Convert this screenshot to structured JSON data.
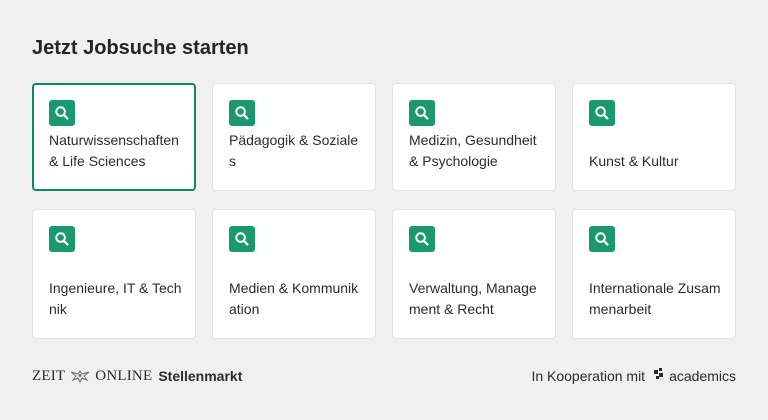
{
  "header": {
    "title": "Jetzt Jobsuche starten"
  },
  "categories": [
    {
      "label": "Naturwissenschaften & Life Sciences",
      "icon": "search-icon",
      "active": true
    },
    {
      "label": "Pädagogik & Soziales",
      "icon": "search-icon"
    },
    {
      "label": "Medizin, Gesundheit & Psychologie",
      "icon": "search-icon"
    },
    {
      "label": "Kunst & Kultur",
      "icon": "search-icon"
    },
    {
      "label": "Ingenieure, IT & Technik",
      "icon": "search-icon"
    },
    {
      "label": "Medien & Kommunikation",
      "icon": "search-icon"
    },
    {
      "label": "Verwaltung, Management & Recht",
      "icon": "search-icon"
    },
    {
      "label": "Internationale Zusammenarbeit",
      "icon": "search-icon"
    }
  ],
  "footer": {
    "brand_zeit": "ZEIT",
    "brand_online": "ONLINE",
    "brand_stellenmarkt": "Stellenmarkt",
    "cooperation_text": "In Kooperation mit",
    "partner_name": "academics"
  },
  "colors": {
    "accent": "#1a9a6c",
    "active_border": "#0f8a5f",
    "background": "#f0f0f0",
    "card": "#ffffff"
  }
}
